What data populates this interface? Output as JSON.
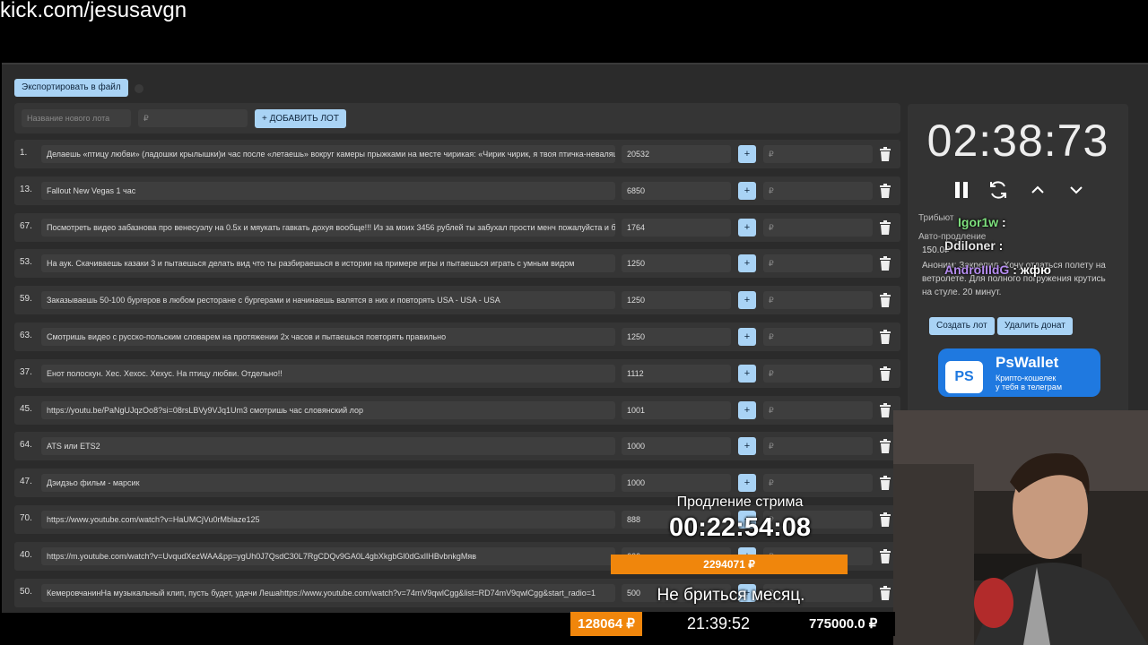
{
  "stream_url": "kick.com/jesusavgn",
  "toolbar": {
    "export_label": "Экспортировать в файл"
  },
  "new_lot": {
    "name_placeholder": "Название нового лота",
    "price_placeholder": "₽",
    "add_label": "+ ДОБАВИТЬ ЛОТ"
  },
  "lots": [
    {
      "num": "1.",
      "title": "Делаешь «птицу любви» (ладошки крылышки)и час после «летаешь» вокруг камеры прыжками на месте чирикая: «Чирик чирик, я твоя птичка-неваляшка",
      "amount": "20532"
    },
    {
      "num": "13.",
      "title": "Fallout New Vegas 1 час",
      "amount": "6850"
    },
    {
      "num": "67.",
      "title": "Посмотреть видео забазнова про венесуэлу на 0.5x и мяукать гавкать дохуя вообще!!! Из за моих 3456 рублей ты забухал прости менч пожалуйста и бо",
      "amount": "1764"
    },
    {
      "num": "53.",
      "title": "На аук. Скачиваешь казаки 3 и пытаешься делать вид что ты разбираешься в истории на примере игры и пытаешься играть с умным видом",
      "amount": "1250"
    },
    {
      "num": "59.",
      "title": "Заказываешь 50-100 бургеров в любом ресторане с бургерами и начинаешь валятся в них и повторять USA - USA - USA",
      "amount": "1250"
    },
    {
      "num": "63.",
      "title": "Смотришь видео с русско-польским словарем на протяжении 2х часов и пытаешься повторять правильно",
      "amount": "1250"
    },
    {
      "num": "37.",
      "title": "Енот полоскун. Хес. Хехос. Хехус. На птицу любви. Отдельно!!",
      "amount": "1112"
    },
    {
      "num": "45.",
      "title": "https://youtu.be/PaNgUJqzOo8?si=08rsLBVy9VJq1Um3 смотришь час словянский лор",
      "amount": "1001"
    },
    {
      "num": "64.",
      "title": "ATS или ETS2",
      "amount": "1000"
    },
    {
      "num": "47.",
      "title": "Дэидзьо фильм - марсик",
      "amount": "1000"
    },
    {
      "num": "70.",
      "title": "https://www.youtube.com/watch?v=HaUMCjVu0rMblaze125",
      "amount": "888"
    },
    {
      "num": "40.",
      "title": "https://m.youtube.com/watch?v=UvqudXezWAA&pp=ygUh0J7QsdC30L7RgCDQv9GA0L4gbXkgbGl0dGxlIHBvbnkgMяв",
      "amount": "666"
    },
    {
      "num": "50.",
      "title": "КемеровчанинНа музыкальный клип, пусть будет, удачи Лешаhttps://www.youtube.com/watch?v=74mV9qwlCgg&list=RD74mV9qwlCgg&start_radio=1",
      "amount": "500"
    }
  ],
  "lot_amount_placeholder": "₽",
  "timer": {
    "value": "02:38:73"
  },
  "side": {
    "tribute_label": "Трибьют",
    "autoextend_label": "Авто-продление",
    "donation_amount": "150.0₽",
    "donation_text": "Аноним: Закрепил. Хочу отдаться полету на ветролете. Для полного погружения крутись на стуле. 20 минут.",
    "create_lot_label": "Создать лот",
    "delete_donation_label": "Удалить донат"
  },
  "chat": [
    {
      "user": "Igor1w",
      "sep": " :",
      "color": "#7ee07e"
    },
    {
      "user": "Ddiloner",
      "sep": " :",
      "color": "#e6e6e6"
    },
    {
      "user": "AndroIIIdG",
      "sep": " : жфю",
      "color": "#b58cf0"
    }
  ],
  "pswallet": {
    "logo": "PS",
    "name": "PsWallet",
    "tagline1": "Крипто-кошелек",
    "tagline2": "у тебя в телеграм"
  },
  "overlay": {
    "extension_label": "Продление стрима",
    "extension_time": "00:22:54:08",
    "total_amount": "2294071 ₽",
    "caption": "Не бриться месяц.",
    "bottom_amount": "128064 ₽",
    "bottom_clock": "21:39:52",
    "bottom_goal": "775000.0 ₽"
  },
  "colors": {
    "accent": "#a9d3f5",
    "orange": "#f0860c",
    "panel": "#353535",
    "input": "#3e3e3e"
  }
}
